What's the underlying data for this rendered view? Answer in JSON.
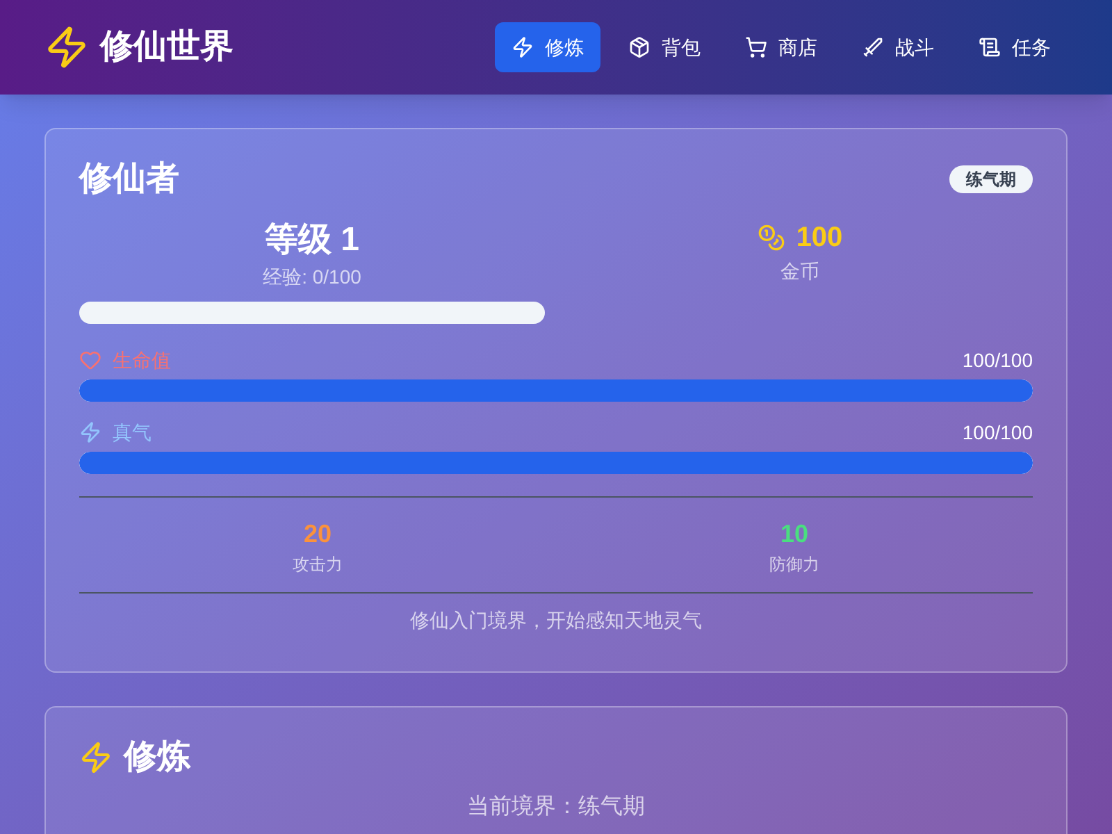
{
  "header": {
    "title": "修仙世界"
  },
  "nav": [
    {
      "label": "修炼",
      "kind": "cultivate",
      "selected": true
    },
    {
      "label": "背包",
      "kind": "bag",
      "selected": false
    },
    {
      "label": "商店",
      "kind": "shop",
      "selected": false
    },
    {
      "label": "战斗",
      "kind": "battle",
      "selected": false
    },
    {
      "label": "任务",
      "kind": "quest",
      "selected": false
    }
  ],
  "character": {
    "title": "修仙者",
    "realm_badge": "练气期",
    "level": "等级 1",
    "exp": "经验: 0/100",
    "exp_bar": {
      "level": 0
    },
    "gold": "100",
    "gold_label": "金币",
    "bars": [
      {
        "kind": "health",
        "label": "生命值",
        "reading": "100/100",
        "level": 1
      },
      {
        "kind": "qi",
        "label": "真气",
        "reading": "100/100",
        "level": 1
      }
    ],
    "stats": [
      {
        "value": "20",
        "label": "攻击力",
        "color": "#fb923c"
      },
      {
        "value": "10",
        "label": "防御力",
        "color": "#4ade80"
      }
    ],
    "description": "修仙入门境界，开始感知天地灵气"
  },
  "cultivation": {
    "title": "修炼",
    "current_realm": "当前境界：练气期"
  }
}
